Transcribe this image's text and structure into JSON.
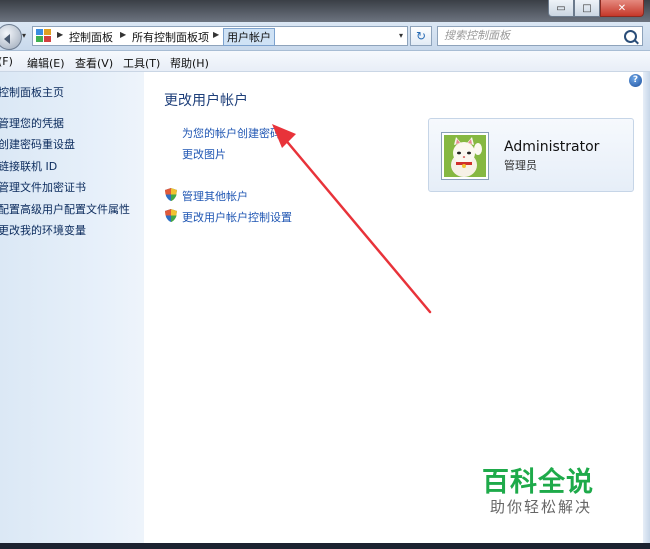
{
  "window": {
    "controls": {
      "minimize": "▭",
      "maximize": "□",
      "close": "✕"
    }
  },
  "address_bar": {
    "crumbs": [
      "控制面板",
      "所有控制面板项",
      "用户帐户"
    ],
    "dropdown_glyph": "▾",
    "refresh_glyph": "↻"
  },
  "search": {
    "placeholder": "搜索控制面板"
  },
  "menu": {
    "items": [
      "(F)",
      "编辑(E)",
      "查看(V)",
      "工具(T)",
      "帮助(H)"
    ]
  },
  "sidebar": {
    "home": "控制面板主页",
    "items": [
      "管理您的凭据",
      "创建密码重设盘",
      "链接联机 ID",
      "管理文件加密证书",
      "配置高级用户配置文件属性",
      "更改我的环境变量"
    ]
  },
  "main": {
    "title": "更改用户帐户",
    "links": [
      "为您的帐户创建密码",
      "更改图片"
    ],
    "shield_links": [
      "管理其他帐户",
      "更改用户帐户控制设置"
    ],
    "help_glyph": "?"
  },
  "account": {
    "name": "Administrator",
    "role": "管理员"
  },
  "watermark": {
    "main": "百科全说",
    "sub": "助你轻松解决"
  },
  "colors": {
    "link": "#1f56b3",
    "title": "#1e3f7a",
    "arrow": "#e8333a",
    "watermark": "#1eaa4a"
  }
}
